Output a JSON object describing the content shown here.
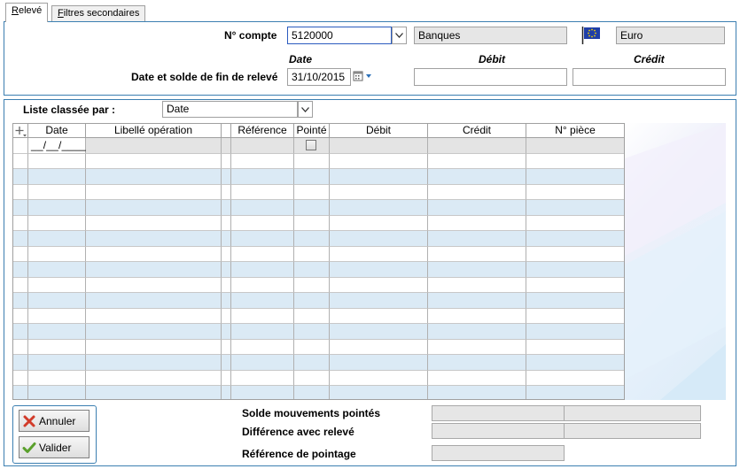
{
  "tabs": [
    {
      "label": "Relevé",
      "accel": "R",
      "rest": "elevé"
    },
    {
      "label": "Filtres secondaires",
      "accel": "F",
      "rest": "iltres secondaires"
    }
  ],
  "header": {
    "account_label": "N° compte",
    "account_value": "5120000",
    "account_name": "Banques",
    "currency": "Euro",
    "col_date": "Date",
    "col_debit": "Débit",
    "col_credit": "Crédit",
    "statement_label": "Date et solde de fin de relevé",
    "statement_date": "31/10/2015",
    "debit_value": "",
    "credit_value": ""
  },
  "list": {
    "sort_label": "Liste classée par :",
    "sort_value": "Date",
    "columns": [
      "Date",
      "Libellé opération",
      "Référence",
      "Pointé",
      "Débit",
      "Crédit",
      "N° pièce"
    ],
    "date_mask": "__/__/____"
  },
  "buttons": {
    "cancel": "Annuler",
    "validate": "Valider"
  },
  "summary": {
    "balance_label": "Solde mouvements pointés",
    "diff_label": "Différence avec relevé",
    "ref_label": "Référence de pointage"
  },
  "colors": {
    "accent_border": "#3c7fb1",
    "row_alt": "#dbeaf5",
    "readonly_bg": "#e6e6e6"
  }
}
